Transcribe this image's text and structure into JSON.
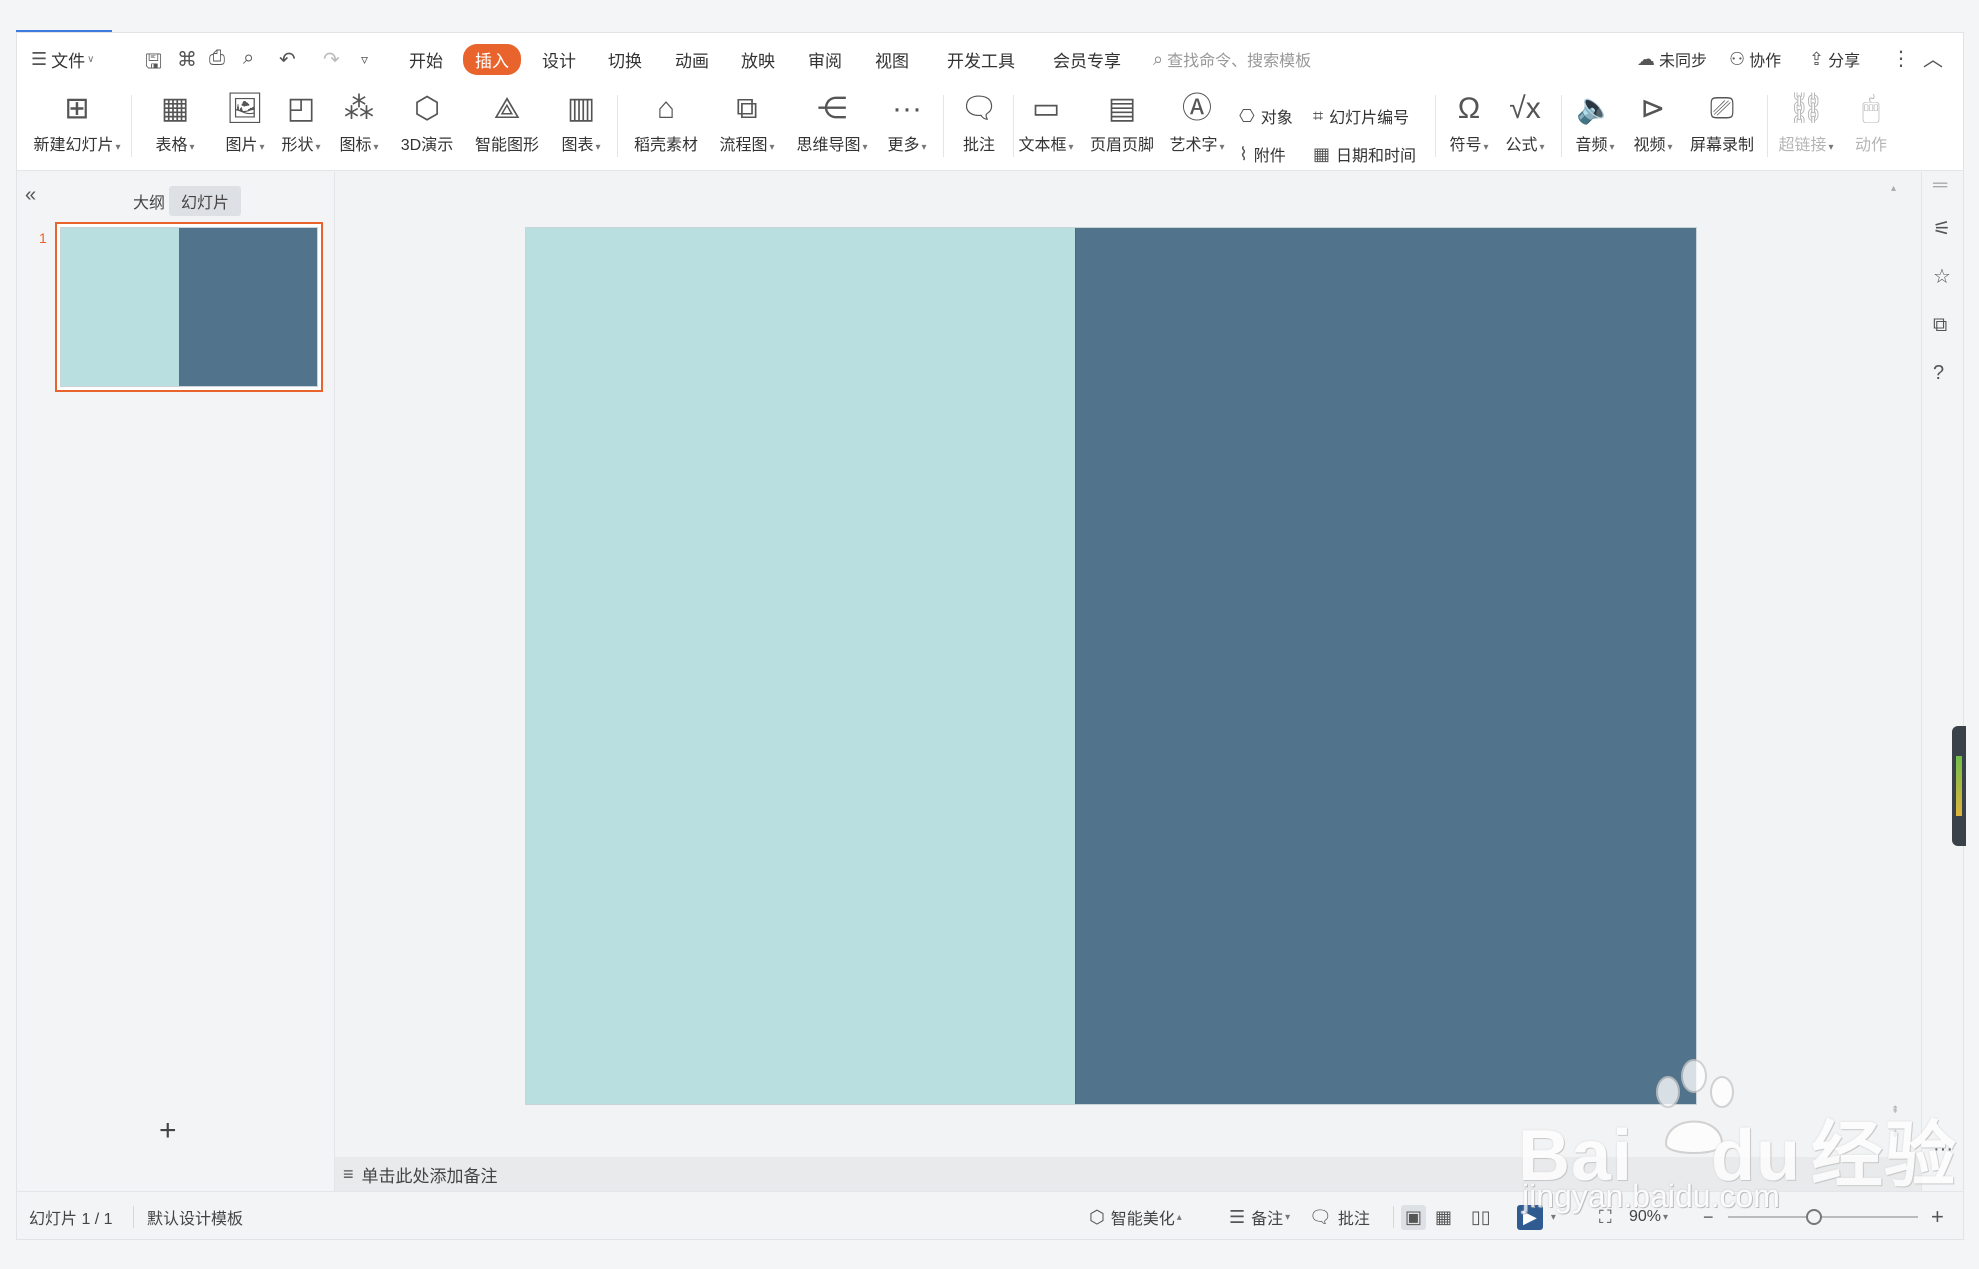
{
  "menubar": {
    "file_label": "文件",
    "tabs": [
      "开始",
      "插入",
      "设计",
      "切换",
      "动画",
      "放映",
      "审阅",
      "视图",
      "开发工具",
      "会员专享"
    ],
    "active_tab": "插入",
    "search_placeholder": "查找命令、搜索模板",
    "sync_label": "未同步",
    "collab_label": "协作",
    "share_label": "分享"
  },
  "ribbon": {
    "new_slide": "新建幻灯片",
    "table": "表格",
    "picture": "图片",
    "shape": "形状",
    "icon": "图标",
    "three_d": "3D演示",
    "smart_graphic": "智能图形",
    "chart": "图表",
    "material": "稻壳素材",
    "flowchart": "流程图",
    "mindmap": "思维导图",
    "more": "更多",
    "comment": "批注",
    "textbox": "文本框",
    "header_footer": "页眉页脚",
    "wordart": "艺术字",
    "object": "对象",
    "attachment": "附件",
    "slide_number": "幻灯片编号",
    "datetime": "日期和时间",
    "symbol": "符号",
    "formula": "公式",
    "audio": "音频",
    "video": "视频",
    "screen_record": "屏幕录制",
    "hyperlink": "超链接",
    "action": "动作"
  },
  "panel": {
    "tab_outline": "大纲",
    "tab_slides": "幻灯片",
    "active_tab": "幻灯片",
    "slide_number": "1"
  },
  "slide": {
    "left_color": "#badfe1",
    "right_color": "#52738c"
  },
  "notes": {
    "placeholder": "单击此处添加备注"
  },
  "status": {
    "slide_counter": "幻灯片 1 / 1",
    "template": "默认设计模板",
    "beautify": "智能美化",
    "notes": "备注",
    "comments": "批注",
    "zoom": "90%"
  },
  "watermark": {
    "brand": "Bai",
    "brand_tail": "du",
    "brand_cn": "经验",
    "url": "jingyan.baidu.com"
  },
  "colors": {
    "accent": "#e8642c",
    "tab_active_bg": "#e8642c"
  }
}
